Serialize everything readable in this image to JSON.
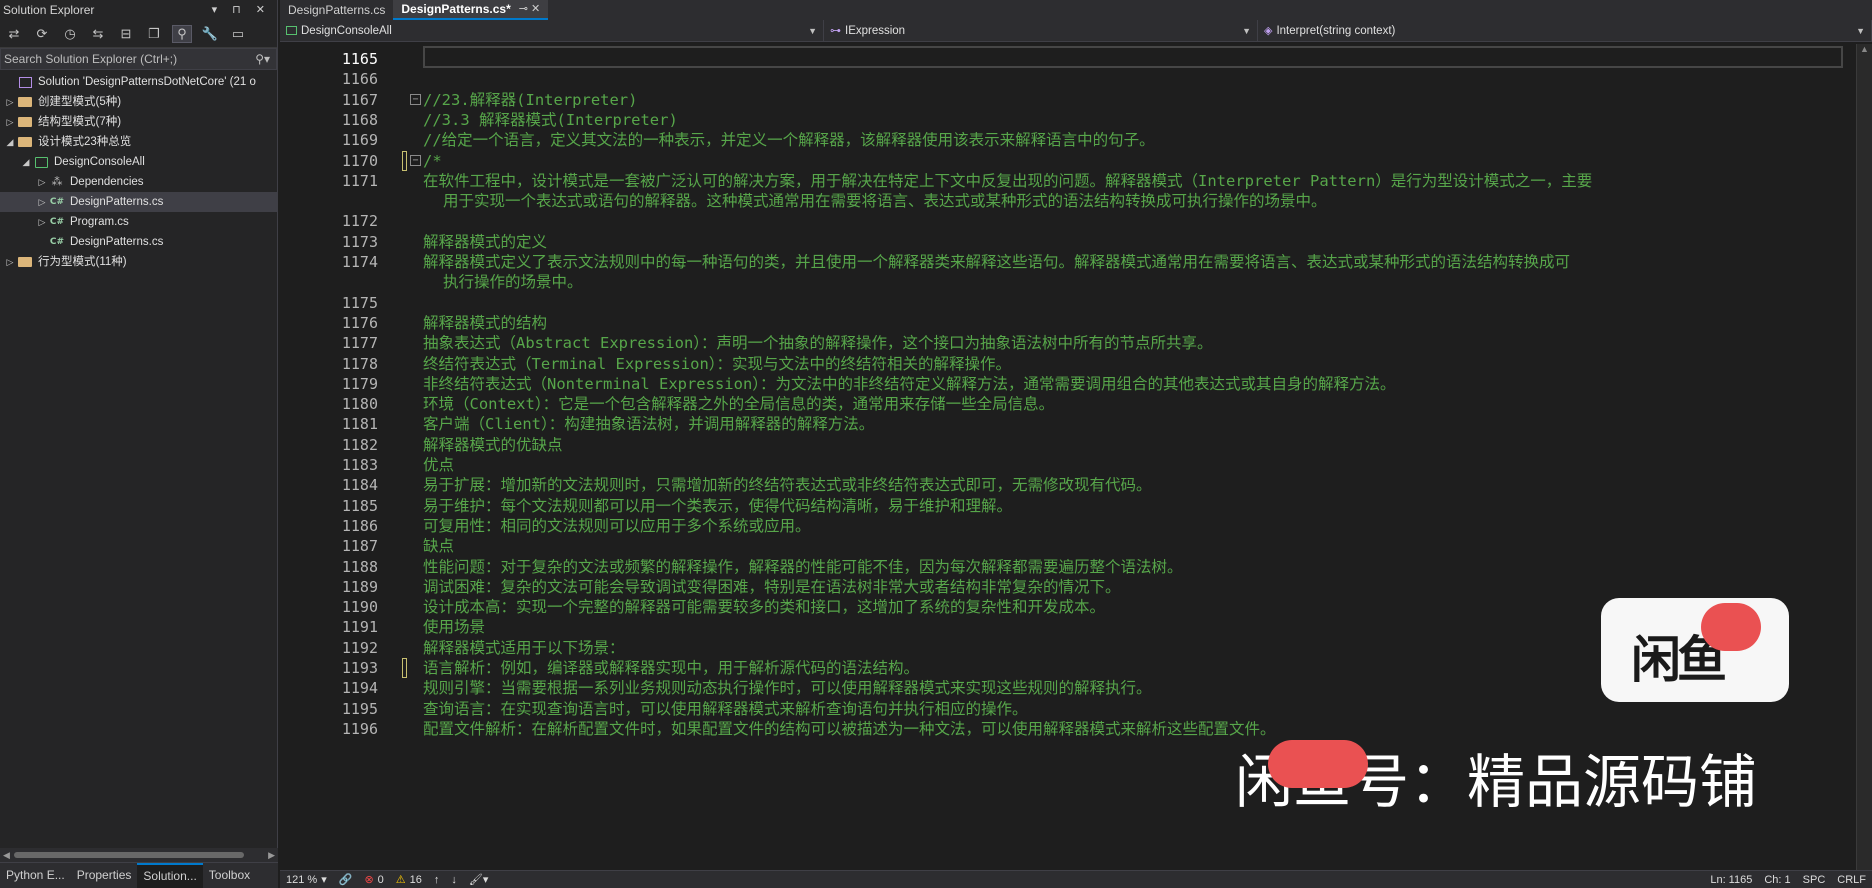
{
  "solution_explorer": {
    "title": "Solution Explorer",
    "title_controls": "▾ ⊓ ✕",
    "search_placeholder": "Search Solution Explorer (Ctrl+;)",
    "tree": [
      {
        "label": "Solution 'DesignPatternsDotNetCore' (21 o",
        "level": 0,
        "arrow": "",
        "icon": "solution-icon"
      },
      {
        "label": "创建型模式(5种)",
        "level": 0,
        "arrow": "▷",
        "icon": "folder-icon"
      },
      {
        "label": "结构型模式(7种)",
        "level": 0,
        "arrow": "▷",
        "icon": "folder-icon"
      },
      {
        "label": "设计模式23种总览",
        "level": 0,
        "arrow": "◢",
        "icon": "folder-icon"
      },
      {
        "label": "DesignConsoleAll",
        "level": 1,
        "arrow": "◢",
        "icon": "project-icon"
      },
      {
        "label": "Dependencies",
        "level": 2,
        "arrow": "▷",
        "icon": "dependencies-icon"
      },
      {
        "label": "DesignPatterns.cs",
        "level": 2,
        "arrow": "▷",
        "icon": "csharp-file-icon",
        "selected": true
      },
      {
        "label": "Program.cs",
        "level": 2,
        "arrow": "▷",
        "icon": "csharp-file-icon"
      },
      {
        "label": "DesignPatterns.cs",
        "level": 2,
        "arrow": "",
        "icon": "csharp-file-icon"
      },
      {
        "label": "行为型模式(11种)",
        "level": 0,
        "arrow": "▷",
        "icon": "folder-icon"
      }
    ],
    "bottom_tabs": [
      "Python E...",
      "Properties",
      "Solution...",
      "Toolbox"
    ]
  },
  "editor": {
    "tabs": [
      {
        "label": "DesignPatterns.cs",
        "active": false
      },
      {
        "label": "DesignPatterns.cs*",
        "active": true
      }
    ],
    "active_tab_icons": "⊸ ✕",
    "nav": {
      "project": "DesignConsoleAll",
      "type": "IExpression",
      "member": "Interpret(string context)"
    },
    "lines": [
      {
        "n": "1165",
        "text": "",
        "current": true
      },
      {
        "n": "1166",
        "text": ""
      },
      {
        "n": "1167",
        "text": "//23.解释器(Interpreter)",
        "fold": "−"
      },
      {
        "n": "1168",
        "text": "//3.3 解释器模式(Interpreter)"
      },
      {
        "n": "1169",
        "text": "//给定一个语言，定义其文法的一种表示，并定义一个解释器，该解释器使用该表示来解释语言中的句子。"
      },
      {
        "n": "1170",
        "text": "/*",
        "fold": "−",
        "change": true
      },
      {
        "n": "1171",
        "text": "在软件工程中，设计模式是一套被广泛认可的解决方案，用于解决在特定上下文中反复出现的问题。解释器模式（Interpreter Pattern）是行为型设计模式之一，主要"
      },
      {
        "n": "",
        "text": "用于实现一个表达式或语句的解释器。这种模式通常用在需要将语言、表达式或某种形式的语法结构转换成可执行操作的场景中。",
        "indent": true
      },
      {
        "n": "1172",
        "text": ""
      },
      {
        "n": "1173",
        "text": "解释器模式的定义"
      },
      {
        "n": "1174",
        "text": "解释器模式定义了表示文法规则中的每一种语句的类，并且使用一个解释器类来解释这些语句。解释器模式通常用在需要将语言、表达式或某种形式的语法结构转换成可"
      },
      {
        "n": "",
        "text": "执行操作的场景中。",
        "indent": true
      },
      {
        "n": "1175",
        "text": ""
      },
      {
        "n": "1176",
        "text": "解释器模式的结构"
      },
      {
        "n": "1177",
        "text": "抽象表达式（Abstract Expression）：声明一个抽象的解释操作，这个接口为抽象语法树中所有的节点所共享。"
      },
      {
        "n": "1178",
        "text": "终结符表达式（Terminal Expression）：实现与文法中的终结符相关的解释操作。"
      },
      {
        "n": "1179",
        "text": "非终结符表达式（Nonterminal Expression）：为文法中的非终结符定义解释方法，通常需要调用组合的其他表达式或其自身的解释方法。"
      },
      {
        "n": "1180",
        "text": "环境（Context）：它是一个包含解释器之外的全局信息的类，通常用来存储一些全局信息。"
      },
      {
        "n": "1181",
        "text": "客户端（Client）：构建抽象语法树，并调用解释器的解释方法。"
      },
      {
        "n": "1182",
        "text": "解释器模式的优缺点"
      },
      {
        "n": "1183",
        "text": "优点"
      },
      {
        "n": "1184",
        "text": "易于扩展：增加新的文法规则时，只需增加新的终结符表达式或非终结符表达式即可，无需修改现有代码。"
      },
      {
        "n": "1185",
        "text": "易于维护：每个文法规则都可以用一个类表示，使得代码结构清晰，易于维护和理解。"
      },
      {
        "n": "1186",
        "text": "可复用性：相同的文法规则可以应用于多个系统或应用。"
      },
      {
        "n": "1187",
        "text": "缺点"
      },
      {
        "n": "1188",
        "text": "性能问题：对于复杂的文法或频繁的解释操作，解释器的性能可能不佳，因为每次解释都需要遍历整个语法树。"
      },
      {
        "n": "1189",
        "text": "调试困难：复杂的文法可能会导致调试变得困难，特别是在语法树非常大或者结构非常复杂的情况下。"
      },
      {
        "n": "1190",
        "text": "设计成本高：实现一个完整的解释器可能需要较多的类和接口，这增加了系统的复杂性和开发成本。"
      },
      {
        "n": "1191",
        "text": "使用场景"
      },
      {
        "n": "1192",
        "text": "解释器模式适用于以下场景："
      },
      {
        "n": "1193",
        "text": "语言解析：例如，编译器或解释器实现中，用于解析源代码的语法结构。",
        "change": true
      },
      {
        "n": "1194",
        "text": "规则引擎：当需要根据一系列业务规则动态执行操作时，可以使用解释器模式来实现这些规则的解释执行。"
      },
      {
        "n": "1195",
        "text": "查询语言：在实现查询语言时，可以使用解释器模式来解析查询语句并执行相应的操作。"
      },
      {
        "n": "1196",
        "text": "配置文件解析：在解析配置文件时，如果配置文件的结构可以被描述为一种文法，可以使用解释器模式来解析这些配置文件。"
      }
    ]
  },
  "status": {
    "zoom": "121 %",
    "errors": "0",
    "warnings": "16",
    "ln": "Ln: 1165",
    "ch": "Ch: 1",
    "spc": "SPC",
    "crlf": "CRLF"
  },
  "watermark": {
    "logo_text": "闲鱼",
    "shop_text": "闲鱼号：精品源码铺"
  }
}
